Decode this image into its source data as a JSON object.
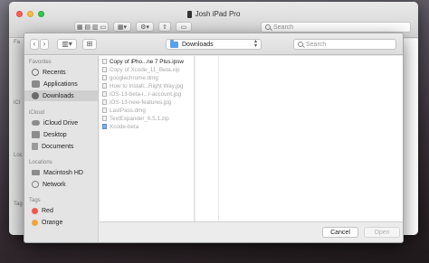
{
  "window": {
    "title": "Josh iPad Pro",
    "search_placeholder": "Search",
    "sidebar_partial_labels": [
      "Fa",
      "iCl",
      "Loc",
      "Tag"
    ]
  },
  "panel": {
    "location": "Downloads",
    "search_placeholder": "Search",
    "sidebar": {
      "favorites_heading": "Favorites",
      "favorites": [
        {
          "label": "Recents",
          "icon": "clock-icon"
        },
        {
          "label": "Applications",
          "icon": "applications-icon"
        },
        {
          "label": "Downloads",
          "icon": "downloads-icon",
          "selected": true
        }
      ],
      "icloud_heading": "iCloud",
      "icloud": [
        {
          "label": "iCloud Drive",
          "icon": "cloud-icon"
        },
        {
          "label": "Desktop",
          "icon": "desktop-icon"
        },
        {
          "label": "Documents",
          "icon": "document-icon"
        }
      ],
      "locations_heading": "Locations",
      "locations": [
        {
          "label": "Macintosh HD",
          "icon": "disk-icon"
        },
        {
          "label": "Network",
          "icon": "globe-icon"
        }
      ],
      "tags_heading": "Tags",
      "tags": [
        {
          "label": "Red",
          "color": "#f0584f"
        },
        {
          "label": "Orange",
          "color": "#f4a33b"
        }
      ]
    },
    "files": [
      {
        "name": "Copy of iPho...ne 7 Plus.ipsw",
        "enabled": true
      },
      {
        "name": "Copy of Xcode_11_Beta.xip",
        "enabled": false
      },
      {
        "name": "googlechrome.dmg",
        "enabled": false
      },
      {
        "name": "How to Install...Right Way.jpg",
        "enabled": false
      },
      {
        "name": "iOS-13-beta-i...r-account.jpg",
        "enabled": false
      },
      {
        "name": "iOS-13-new-features.jpg",
        "enabled": false
      },
      {
        "name": "LastPass.dmg",
        "enabled": false
      },
      {
        "name": "TextExpander_6.5.1.zip",
        "enabled": false
      },
      {
        "name": "Xcode-beta",
        "enabled": false
      }
    ],
    "buttons": {
      "cancel": "Cancel",
      "open": "Open"
    }
  }
}
